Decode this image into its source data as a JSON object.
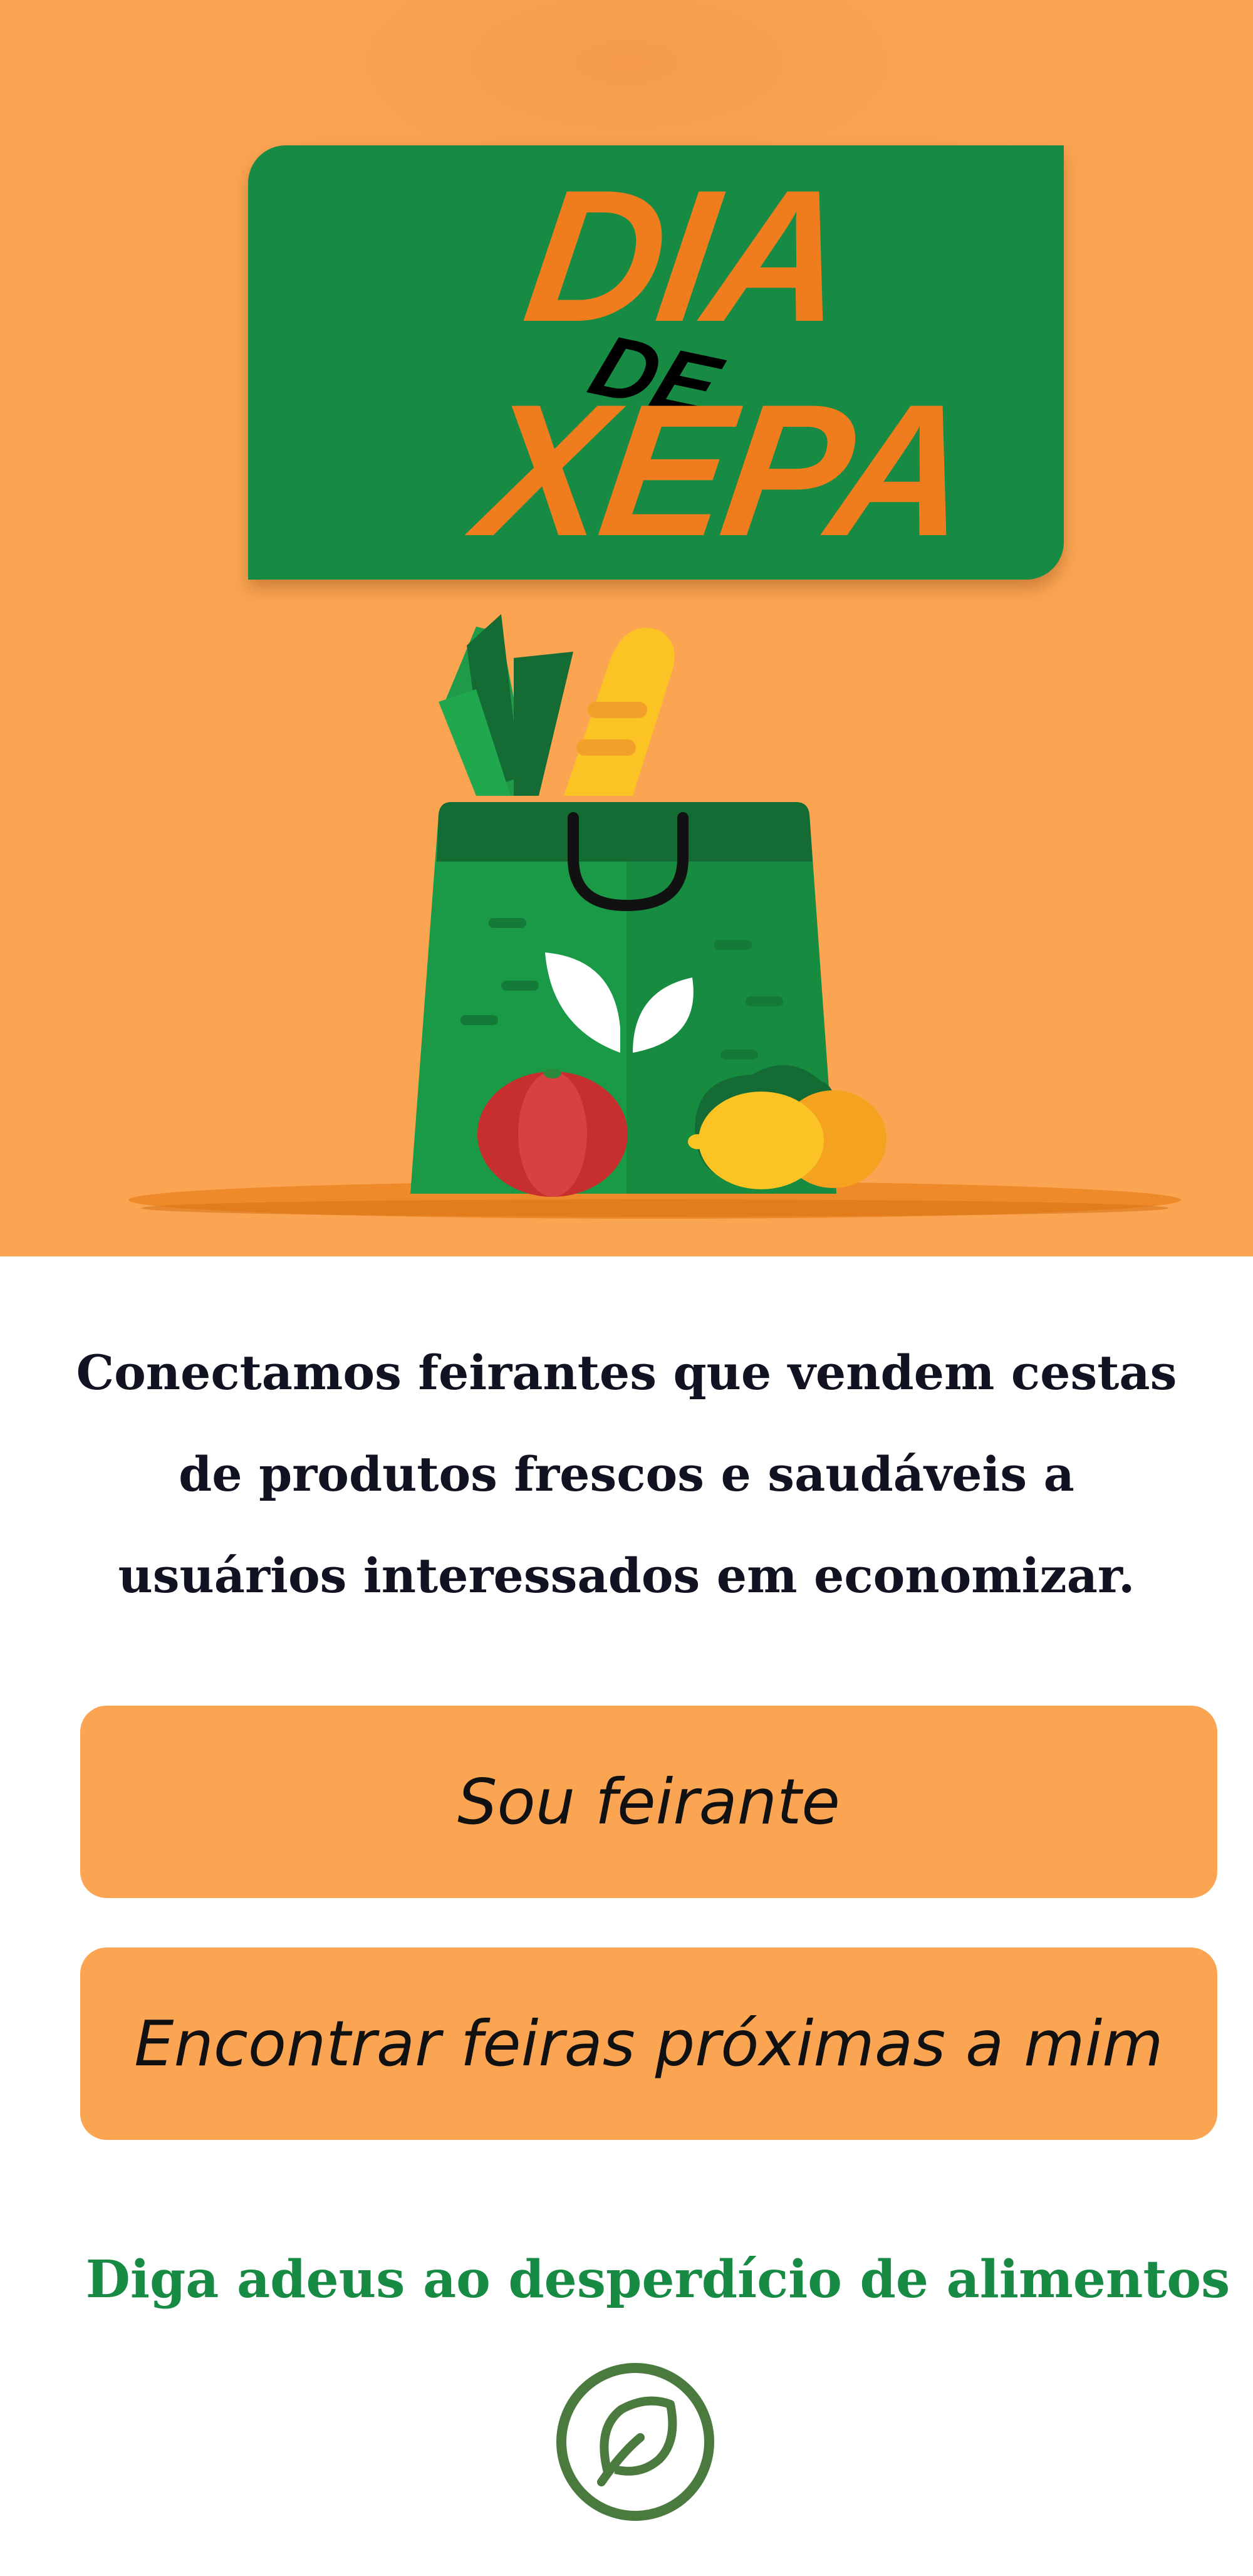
{
  "logo": {
    "line1": "DIA",
    "line2": "DE",
    "line3": "XEPA"
  },
  "illustration": {
    "icon": "grocery-bag-icon",
    "items": [
      "leek-icon",
      "bread-icon",
      "tomato-icon",
      "lemon-icon",
      "orange-icon",
      "leaf-icon"
    ]
  },
  "tagline": "Conectamos feirantes que vendem cestas de produtos frescos e saudáveis a usuários interessados em economizar.",
  "buttons": {
    "vendor": "Sou feirante",
    "find_markets": "Encontrar feiras próximas a mim"
  },
  "slogan": "Diga adeus ao desperdício de alimentos",
  "footer_icon": "leaf-circle-icon",
  "colors": {
    "hero_background": "#fba553",
    "brand_green": "#178b44",
    "logo_orange": "#ef7d1e",
    "button_orange": "#fba553",
    "text_dark": "#111322"
  }
}
